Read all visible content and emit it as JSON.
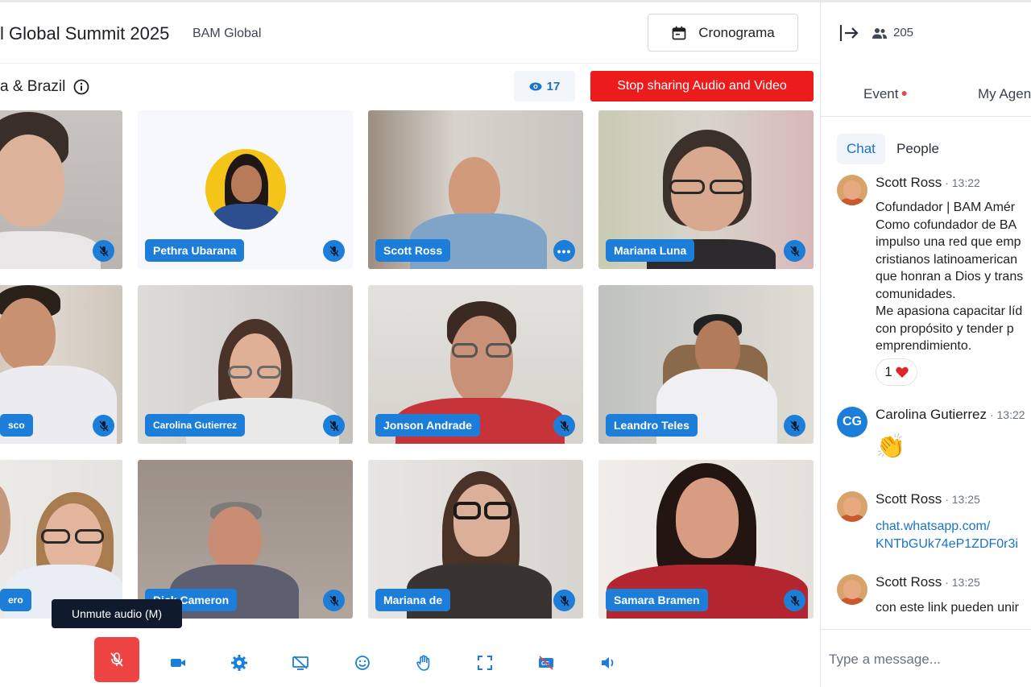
{
  "header": {
    "event_title": "l Global Summit 2025",
    "org_name": "BAM Global",
    "schedule_button": "Cronograma"
  },
  "session": {
    "name": "a & Brazil",
    "viewers": "17",
    "stop_sharing_label": "Stop sharing Audio and Video"
  },
  "participants": [
    {
      "name": "",
      "status": "muted"
    },
    {
      "name": "Pethra Ubarana",
      "status": "muted"
    },
    {
      "name": "Scott Ross",
      "status": "more-options"
    },
    {
      "name": "Mariana Luna",
      "status": "muted"
    },
    {
      "name": "sco",
      "status": "muted"
    },
    {
      "name": "Carolina Gutierrez",
      "status": "muted"
    },
    {
      "name": "Jonson Andrade",
      "status": "muted"
    },
    {
      "name": "Leandro Teles",
      "status": "muted"
    },
    {
      "name": "ero",
      "status": "muted"
    },
    {
      "name": "Dick Cameron",
      "status": "muted"
    },
    {
      "name": "Mariana de",
      "status": "muted"
    },
    {
      "name": "Samara Bramen",
      "status": "muted"
    }
  ],
  "tooltip": "Unmute audio (M)",
  "toolbar": {
    "buttons": [
      "mic-off-icon",
      "video-camera-icon",
      "settings-gear-icon",
      "screen-share-off-icon",
      "emoji-icon",
      "raise-hand-icon",
      "fullscreen-icon",
      "captions-off-icon",
      "speaker-icon"
    ],
    "accent": "#1d7ed9",
    "mute_color": "#ef4444"
  },
  "panel": {
    "attendee_count": "205",
    "tabs": {
      "event": "Event",
      "my_agenda": "My Agen"
    },
    "subtabs": {
      "chat": "Chat",
      "people": "People"
    },
    "messages": [
      {
        "author": "Scott Ross",
        "time": "13:22",
        "text": "Cofundador | BAM Amér\nComo cofundador de BA\nimpulso una red que emp\ncristianos latinoamerican\nque honran a Dios y trans\ncomunidades.\nMe apasiona capacitar líd\ncon propósito y tender p\nemprendimiento.",
        "reaction_count": "1"
      },
      {
        "author": "Carolina Gutierrez",
        "initials": "CG",
        "time": "13:22",
        "emoji": "👏"
      },
      {
        "author": "Scott Ross",
        "time": "13:25",
        "link": "chat.whatsapp.com/\nKNTbGUk74eP1ZDF0r3i"
      },
      {
        "author": "Scott Ross",
        "time": "13:25",
        "text": "con este link pueden unir"
      }
    ],
    "input_placeholder": "Type a message..."
  }
}
